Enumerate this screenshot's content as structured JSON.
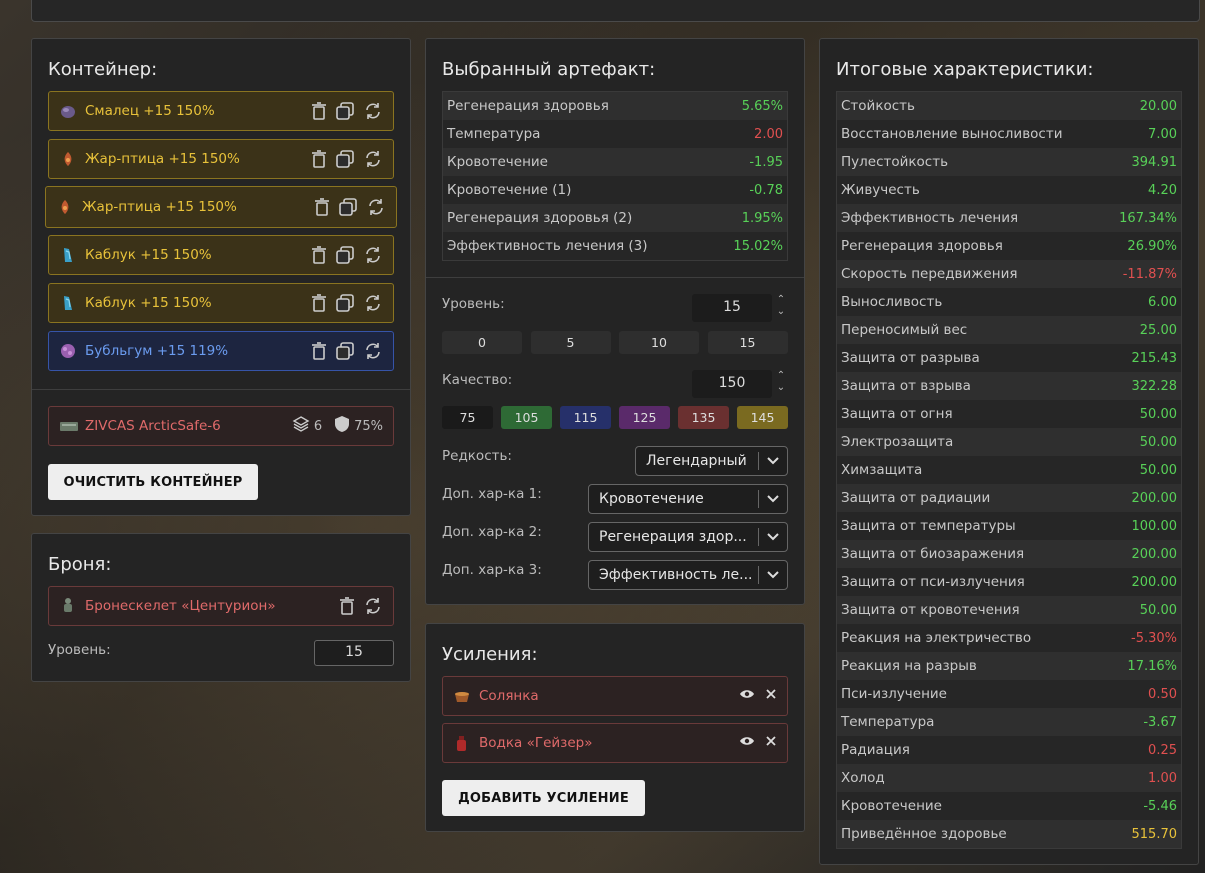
{
  "container": {
    "title": "Контейнер:",
    "items": [
      {
        "name": "Смалец +15 150%",
        "style": "gold",
        "icon": "smalets-artifact-icon"
      },
      {
        "name": "Жар-птица +15 150%",
        "style": "gold",
        "icon": "zhar-ptitsa-artifact-icon"
      },
      {
        "name": "Жар-птица +15 150%",
        "style": "gold",
        "icon": "zhar-ptitsa-artifact-icon"
      },
      {
        "name": "Каблук +15 150%",
        "style": "gold",
        "icon": "kabluk-artifact-icon"
      },
      {
        "name": "Каблук +15 150%",
        "style": "gold",
        "icon": "kabluk-artifact-icon"
      },
      {
        "name": "Бубльгум +15 119%",
        "style": "blue",
        "icon": "bublgum-artifact-icon"
      }
    ],
    "case": {
      "name": "ZIVCAS ArcticSafe-6",
      "slots": "6",
      "protection": "75%"
    },
    "clear_label": "ОЧИСТИТЬ КОНТЕЙНЕР"
  },
  "armor": {
    "title": "Броня:",
    "name": "Бронескелет «Центурион»",
    "level_label": "Уровень:",
    "level": "15"
  },
  "artifact": {
    "title": "Выбранный артефакт:",
    "stats": [
      {
        "name": "Регенерация здоровья",
        "value": "5.65%",
        "color": "g"
      },
      {
        "name": "Температура",
        "value": "2.00",
        "color": "r"
      },
      {
        "name": "Кровотечение",
        "value": "-1.95",
        "color": "g"
      },
      {
        "name": "Кровотечение (1)",
        "value": "-0.78",
        "color": "g"
      },
      {
        "name": "Регенерация здоровья (2)",
        "value": "1.95%",
        "color": "g"
      },
      {
        "name": "Эффективность лечения (3)",
        "value": "15.02%",
        "color": "g"
      }
    ],
    "level_label": "Уровень:",
    "level": "15",
    "level_presets": [
      "0",
      "5",
      "10",
      "15"
    ],
    "quality_label": "Качество:",
    "quality": "150",
    "quality_presets": [
      {
        "label": "75",
        "color": "#1a1a1a"
      },
      {
        "label": "105",
        "color": "#2e6a35"
      },
      {
        "label": "115",
        "color": "#26306a"
      },
      {
        "label": "125",
        "color": "#5a2a6a"
      },
      {
        "label": "135",
        "color": "#6a3030"
      },
      {
        "label": "145",
        "color": "#7a6a20"
      }
    ],
    "rarity_label": "Редкость:",
    "rarity": "Легендарный",
    "extra1_label": "Доп. хар-ка 1:",
    "extra1": "Кровотечение",
    "extra2_label": "Доп. хар-ка 2:",
    "extra2": "Регенерация здор...",
    "extra3_label": "Доп. хар-ка 3:",
    "extra3": "Эффективность ле..."
  },
  "boosts": {
    "title": "Усиления:",
    "items": [
      {
        "name": "Солянка"
      },
      {
        "name": "Водка «Гейзер»"
      }
    ],
    "add_label": "ДОБАВИТЬ УСИЛЕНИЕ"
  },
  "totals": {
    "title": "Итоговые характеристики:",
    "stats": [
      {
        "name": "Стойкость",
        "value": "20.00",
        "color": "g"
      },
      {
        "name": "Восстановление выносливости",
        "value": "7.00",
        "color": "g"
      },
      {
        "name": "Пулестойкость",
        "value": "394.91",
        "color": "g"
      },
      {
        "name": "Живучесть",
        "value": "4.20",
        "color": "g"
      },
      {
        "name": "Эффективность лечения",
        "value": "167.34%",
        "color": "g"
      },
      {
        "name": "Регенерация здоровья",
        "value": "26.90%",
        "color": "g"
      },
      {
        "name": "Скорость передвижения",
        "value": "-11.87%",
        "color": "r"
      },
      {
        "name": "Выносливость",
        "value": "6.00",
        "color": "g"
      },
      {
        "name": "Переносимый вес",
        "value": "25.00",
        "color": "g"
      },
      {
        "name": "Защита от разрыва",
        "value": "215.43",
        "color": "g"
      },
      {
        "name": "Защита от взрыва",
        "value": "322.28",
        "color": "g"
      },
      {
        "name": "Защита от огня",
        "value": "50.00",
        "color": "g"
      },
      {
        "name": "Электрозащита",
        "value": "50.00",
        "color": "g"
      },
      {
        "name": "Химзащита",
        "value": "50.00",
        "color": "g"
      },
      {
        "name": "Защита от радиации",
        "value": "200.00",
        "color": "g"
      },
      {
        "name": "Защита от температуры",
        "value": "100.00",
        "color": "g"
      },
      {
        "name": "Защита от биозаражения",
        "value": "200.00",
        "color": "g"
      },
      {
        "name": "Защита от пси-излучения",
        "value": "200.00",
        "color": "g"
      },
      {
        "name": "Защита от кровотечения",
        "value": "50.00",
        "color": "g"
      },
      {
        "name": "Реакция на электричество",
        "value": "-5.30%",
        "color": "r"
      },
      {
        "name": "Реакция на разрыв",
        "value": "17.16%",
        "color": "g"
      },
      {
        "name": "Пси-излучение",
        "value": "0.50",
        "color": "r"
      },
      {
        "name": "Температура",
        "value": "-3.67",
        "color": "g"
      },
      {
        "name": "Радиация",
        "value": "0.25",
        "color": "r"
      },
      {
        "name": "Холод",
        "value": "1.00",
        "color": "r"
      },
      {
        "name": "Кровотечение",
        "value": "-5.46",
        "color": "g"
      },
      {
        "name": "Приведённое здоровье",
        "value": "515.70",
        "color": "y"
      }
    ]
  }
}
